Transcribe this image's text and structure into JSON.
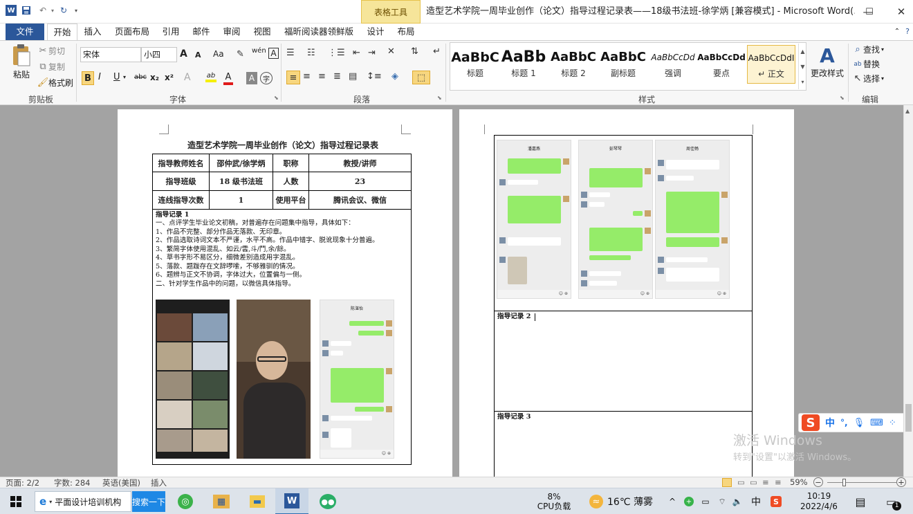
{
  "app": {
    "doc_title": "造型艺术学院一周毕业创作（论文）指导过程记录表——18级书法班-徐学炳 [兼容模式] - Microsoft Word(...",
    "context_tab": "表格工具",
    "window_controls": {
      "minimize": "—",
      "restore": "☐",
      "close": "✕"
    },
    "help": "?"
  },
  "tabs": [
    "文件",
    "开始",
    "插入",
    "页面布局",
    "引用",
    "邮件",
    "审阅",
    "视图",
    "福昕阅读器领鲜版",
    "设计",
    "布局"
  ],
  "ribbon": {
    "clipboard": {
      "paste": "粘贴",
      "cut": "剪切",
      "copy": "复制",
      "format_painter": "格式刷",
      "label": "剪贴板"
    },
    "font": {
      "font_name": "宋体",
      "font_size": "小四",
      "label": "字体",
      "bold": "B",
      "italic": "I",
      "underline": "U",
      "strike": "abc",
      "sub": "x₂",
      "sup": "x²",
      "grow": "A",
      "shrink": "A",
      "case": "Aa",
      "pinyin": "文",
      "char_border": "A",
      "phonetic": "wén",
      "text_effect": "A",
      "highlight": "ab",
      "font_color": "A",
      "char_shade": "A",
      "enclose": "字"
    },
    "paragraph": {
      "label": "段落"
    },
    "styles": {
      "label": "样式",
      "items": [
        {
          "sample": "AaBbC",
          "name": "标题"
        },
        {
          "sample": "AaBb",
          "name": "标题 1"
        },
        {
          "sample": "AaBbC",
          "name": "标题 2"
        },
        {
          "sample": "AaBbC",
          "name": "副标题"
        },
        {
          "sample": "AaBbCcDd",
          "name": "强调"
        },
        {
          "sample": "AaBbCcDd",
          "name": "要点"
        },
        {
          "sample": "AaBbCcDdI",
          "name": "↵ 正文"
        }
      ],
      "change_styles": "更改样式"
    },
    "editing": {
      "find": "查找",
      "replace": "替换",
      "select": "选择",
      "label": "编辑"
    }
  },
  "document": {
    "left_page": {
      "title": "造型艺术学院一周毕业创作（论文）指导过程记录表",
      "table": {
        "row1": [
          "指导教师姓名",
          "邵仲武/徐学炳",
          "职称",
          "教授/讲师"
        ],
        "row2": [
          "指导班级",
          "18 级书法班",
          "人数",
          "23"
        ],
        "row3": [
          "连线指导次数",
          "1",
          "使用平台",
          "腾讯会议、微信"
        ]
      },
      "record_title": "指导记录 1",
      "record_lines": [
        "一、点评学生毕业论文初稿，对普遍存在问题集中指导，具体如下：",
        "1、作品不完整、部分作品无落款、无印章。",
        "2、作品选取诗词文本不严谨，水平不高。作品中错字、脱讹现象十分普遍。",
        "3、繁简字体使用混乱、如云/雲,斗/鬥,余/餘。",
        "4、草书字形不易区分，细微差别造成用字混乱。",
        "5、落款、题跋存在文辞啰嗦，不够雅驯的情况。",
        "6、题辨与正文不协调，字体过大，位置偏与一侧。",
        "二、针对学生作品中的问题，以微信具体指导。"
      ],
      "chat_title": "陈湛怡"
    },
    "right_page": {
      "chat_titles": [
        "潘嘉燕",
        "彭琴琴",
        "周佳畅"
      ],
      "record2_title": "指导记录 2",
      "record3_title": "指导记录 3"
    }
  },
  "watermark": {
    "line1": "激活 Windows",
    "line2": "转到\"设置\"以激活 Windows。"
  },
  "ime": {
    "logo": "S",
    "lang": "中",
    "punct": "°,"
  },
  "status": {
    "page": "页面: 2/2",
    "words": "字数: 284",
    "lang": "英语(美国)",
    "mode": "插入",
    "zoom": "59%",
    "minus": "−",
    "plus": "+"
  },
  "taskbar": {
    "ie_label": "平面设计培训机构",
    "search_btn": "搜索一下",
    "cpu_value": "8%",
    "cpu_label": "CPU负载",
    "weather": "16℃ 薄雾",
    "ime_lang": "中",
    "time": "10:19",
    "date": "2022/4/6",
    "notif_count": "1"
  }
}
